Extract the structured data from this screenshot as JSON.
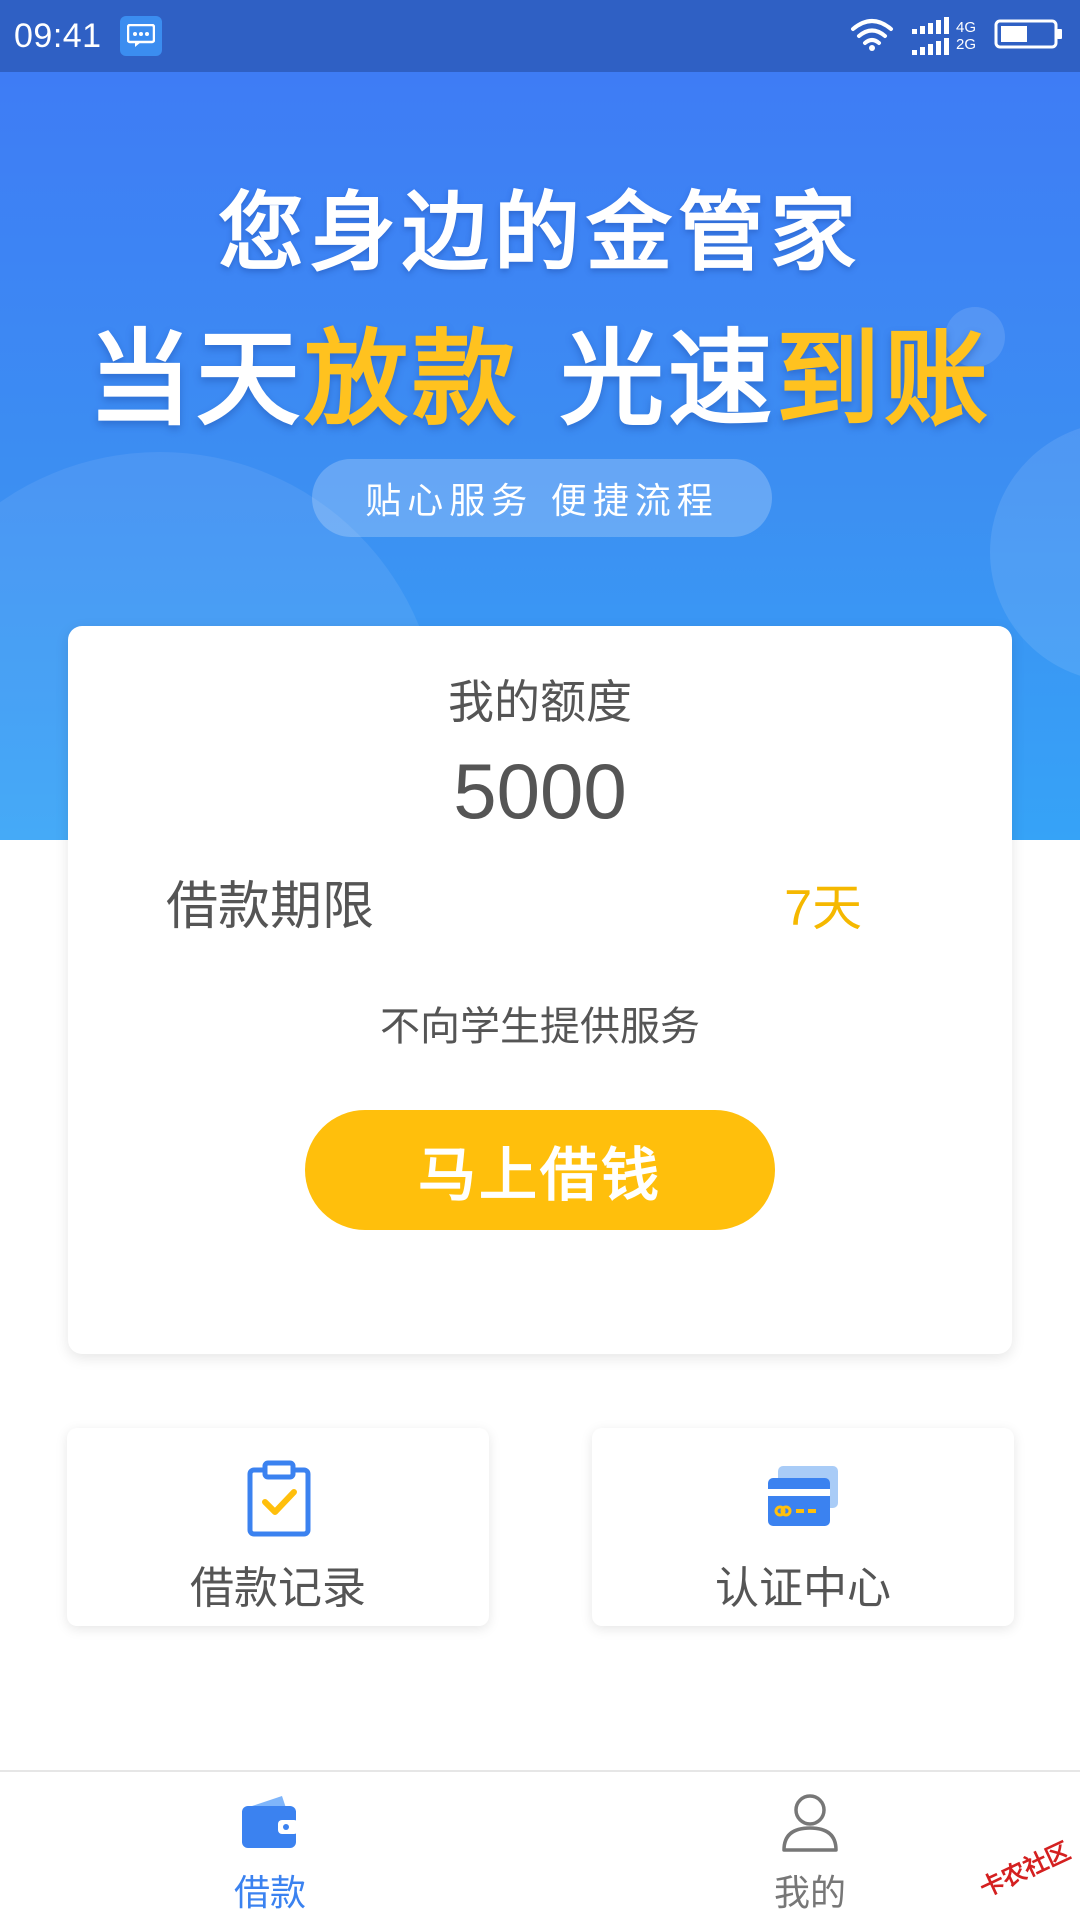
{
  "status_bar": {
    "time": "09:41",
    "network_top": "4G",
    "network_bottom": "2G",
    "icons": [
      "message-icon",
      "wifi-icon",
      "signal-icon",
      "battery-icon"
    ]
  },
  "hero": {
    "title": "您身边的金管家",
    "slogan": {
      "part1": "当天",
      "part1_highlight": "放款",
      "part2": "光速",
      "part2_highlight": "到账"
    },
    "pill_text": "贴心服务 便捷流程"
  },
  "quota_card": {
    "label": "我的额度",
    "amount": "5000",
    "term_label": "借款期限",
    "term_value": "7天",
    "notice": "不向学生提供服务",
    "button_label": "马上借钱"
  },
  "tiles": [
    {
      "label": "借款记录",
      "icon": "clipboard-check-icon"
    },
    {
      "label": "认证中心",
      "icon": "credit-card-icon"
    }
  ],
  "bottom_nav": [
    {
      "label": "借款",
      "icon": "wallet-icon",
      "active": true
    },
    {
      "label": "我的",
      "icon": "user-icon",
      "active": false
    }
  ],
  "watermark": "卡农社区",
  "colors": {
    "status_bar": "#2f60c4",
    "hero_top": "#3e7cf5",
    "hero_bottom": "#36a3f7",
    "highlight_yellow": "#ffc21f",
    "button_yellow": "#ffbf0c",
    "active_blue": "#3b82f0",
    "text_gray": "#555555"
  }
}
